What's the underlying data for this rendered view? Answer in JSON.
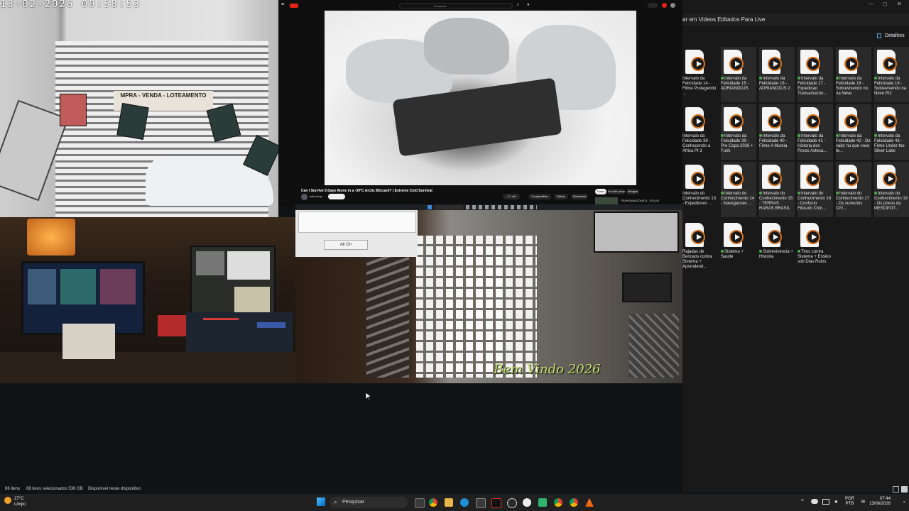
{
  "camera": {
    "timestamp": "13-02-2026 09:58:53",
    "sign_text": "MPRA - VENDA - LOTEAMENTO"
  },
  "youtube": {
    "search_placeholder": "Pesquisar",
    "video_title": "Can I Survive 5 Days Alone in a -39°C Arctic Blizzard? | Extreme Cold Survival",
    "channel": "wild camp",
    "actions": [
      "1,1 mil",
      "Compartilhar",
      "Salvar",
      "Download"
    ],
    "chips": [
      "Todos",
      "Do wild camp",
      "Afinigos"
    ],
    "upnext": "TRANSAMAZONICA - VOLUE"
  },
  "room_overlay": {
    "button": "All On",
    "caption": "Bem Vindo 2026"
  },
  "explorer": {
    "path": "ar em Videos Editados Para Live",
    "details_label": "Detalhes",
    "files": [
      {
        "label": "Intervalo da Felicidade 14 - Filme Protegendo ...",
        "sync": false
      },
      {
        "label": "Intervalo da Felicidade 15 - ADRIANODJS",
        "sync": true
      },
      {
        "label": "Intervalo da Felicidade 16 - ADRIANODJS 2",
        "sync": true
      },
      {
        "label": "Intervalo da Felicidade 17 - Expedicao Transamazon...",
        "sync": true
      },
      {
        "label": "Intervalo da Felicidade 18 - Sobrevivendo no na Neve",
        "sync": true
      },
      {
        "label": "Intervalo da Felicidade 19 - Sobrevivendo na Neve Pt2",
        "sync": true
      },
      {
        "label": "Intervalo da Felicidade 38 - Conhecendo a Africa Pt 3",
        "sync": false
      },
      {
        "label": "Intervalo da Felicidade 39 - Pre Copa 2026 + Funk",
        "sync": true
      },
      {
        "label": "Intervalo da Felicidade 40 - Filme A Mumia",
        "sync": true
      },
      {
        "label": "Intervalo da Felicidade 41 - Historia dos Povos Asteca...",
        "sync": true
      },
      {
        "label": "Intervalo da Felicidade 42 - De valor no que voce te...",
        "sync": true
      },
      {
        "label": "Intervalo da Felicidade 43 - Filme Under the Silver Lake",
        "sync": true
      },
      {
        "label": "Intervalo do Conhecimento 13 - Expedicoes ...",
        "sync": false
      },
      {
        "label": "Intervalo do Conhecimento 14 - Navegacoes ...",
        "sync": true
      },
      {
        "label": "Intervalo do Conhecimento 15 - TERRAS RARAS BRASIL",
        "sync": true
      },
      {
        "label": "Intervalo do Conhecimento 16 - Confucio Filosofo Chin...",
        "sync": true
      },
      {
        "label": "Intervalo do Conhecimento 17 - Os sumerios CIV...",
        "sync": true
      },
      {
        "label": "Intervalo do Conhecimento 18 - Os povos da MESOPOT...",
        "sync": true
      },
      {
        "label": "Rajadas de Bencaos contra Sistema + Aprendend...",
        "sync": false
      },
      {
        "label": "Sistema + Saude",
        "sync": true
      },
      {
        "label": "Sobrevivencia + Historia",
        "sync": true
      },
      {
        "label": "Tiros contra Sistema + Ensino sob Dias Ruins",
        "sync": true
      }
    ],
    "status": {
      "items": "86 itens",
      "selected": "68 itens selecionados  536 GB",
      "availability": "Disponível neste dispositivo"
    }
  },
  "taskbar": {
    "weather_temp": "27°C",
    "weather_desc": "Limpo",
    "search_label": "Pesquisar",
    "lang": "POR",
    "lang2": "PTB",
    "time": "07:44",
    "date": "13/08/2026"
  }
}
